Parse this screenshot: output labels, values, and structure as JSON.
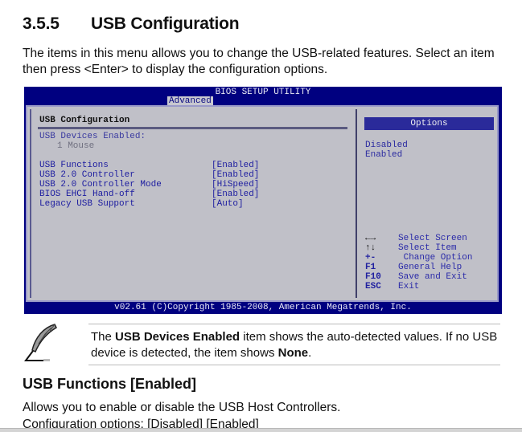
{
  "section": {
    "number": "3.5.5",
    "title": "USB Configuration",
    "intro": "The items in this menu allows you to change the USB-related features. Select an item then press <Enter> to display the configuration options."
  },
  "bios": {
    "title": "BIOS SETUP UTILITY",
    "active_tab": "Advanced",
    "panel_title": "USB Configuration",
    "devices_heading": "USB Devices Enabled:",
    "devices_value": "1 Mouse",
    "items": [
      {
        "label": "USB Functions",
        "value": "[Enabled]"
      },
      {
        "label": "USB 2.0 Controller",
        "value": "[Enabled]"
      },
      {
        "label": "USB 2.0 Controller Mode",
        "value": "[HiSpeed]"
      },
      {
        "label": "BIOS EHCI Hand-off",
        "value": "[Enabled]"
      },
      {
        "label": "Legacy USB Support",
        "value": "[Auto]"
      }
    ],
    "options_header": "Options",
    "options": [
      "Disabled",
      "Enabled"
    ],
    "keys": [
      {
        "key": "←→",
        "desc": "Select Screen",
        "icon": "left-right-arrows-icon"
      },
      {
        "key": "↑↓",
        "desc": "Select Item",
        "icon": "up-down-arrows-icon"
      },
      {
        "key": "+-",
        "desc": " Change Option",
        "icon": "plus-minus-icon"
      },
      {
        "key": "F1",
        "desc": "General Help"
      },
      {
        "key": "F10",
        "desc": "Save and Exit"
      },
      {
        "key": "ESC",
        "desc": "Exit"
      }
    ],
    "footer": "v02.61 (C)Copyright 1985-2008, American Megatrends, Inc."
  },
  "note": {
    "icon": "quill-pen-icon",
    "pre": "The ",
    "bold1": "USB Devices Enabled",
    "mid": " item shows the auto-detected values. If no USB device is detected, the item shows ",
    "bold2": "None",
    "post": "."
  },
  "subsection": {
    "title": "USB Functions [Enabled]",
    "description": "Allows you to enable or disable the USB Host Controllers.",
    "config_options": "Configuration options: [Disabled] [Enabled]"
  }
}
